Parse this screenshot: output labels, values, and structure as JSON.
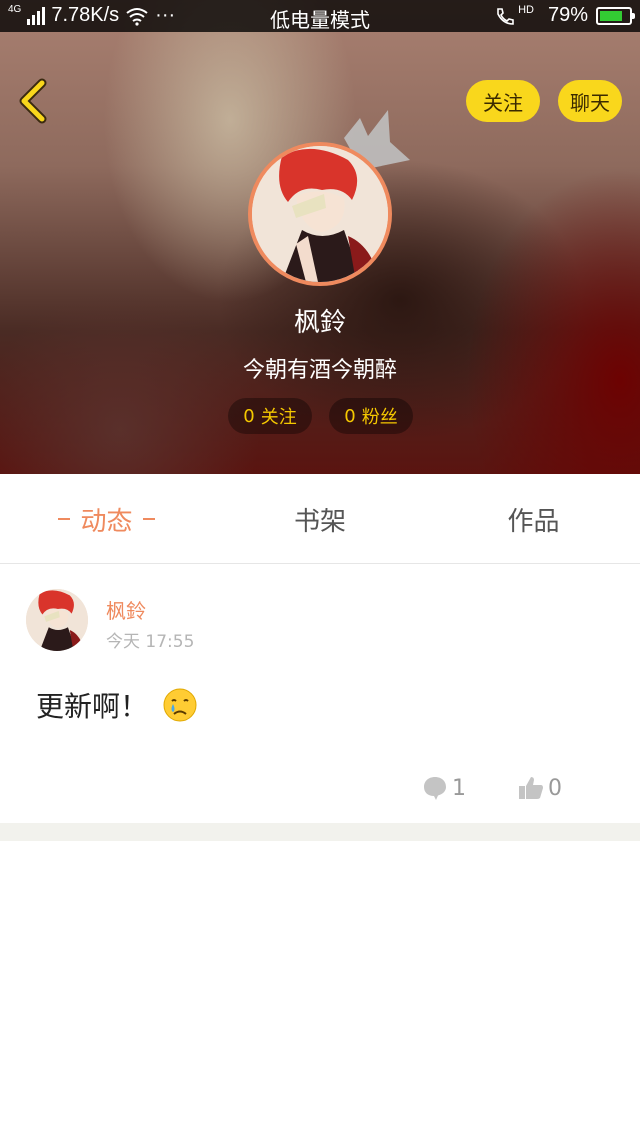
{
  "status_bar": {
    "network": "4G",
    "speed": "7.78K/s",
    "more": "···",
    "mode": "低电量模式",
    "hd": "HD",
    "battery": "79%",
    "battery_level": 0.79
  },
  "header": {
    "follow_label": "关注",
    "chat_label": "聊天",
    "name": "枫鈴",
    "bio": "今朝有酒今朝醉",
    "following_count": "0",
    "following_label": "关注",
    "fans_count": "0",
    "fans_label": "粉丝"
  },
  "tabs": [
    {
      "label": "动态",
      "active": true
    },
    {
      "label": "书架",
      "active": false
    },
    {
      "label": "作品",
      "active": false
    }
  ],
  "post": {
    "author": "枫鈴",
    "time": "今天 17:55",
    "text": "更新啊！",
    "comments": "1",
    "likes": "0"
  },
  "colors": {
    "accent": "#ef8a5e",
    "pill_yellow": "#f9d71c",
    "stat_yellow": "#f5c800"
  },
  "icons": [
    "back-icon",
    "crown-icon",
    "comment-icon",
    "like-icon",
    "crying-emoji-icon",
    "wifi-icon",
    "signal-icon",
    "battery-icon",
    "call-icon"
  ]
}
